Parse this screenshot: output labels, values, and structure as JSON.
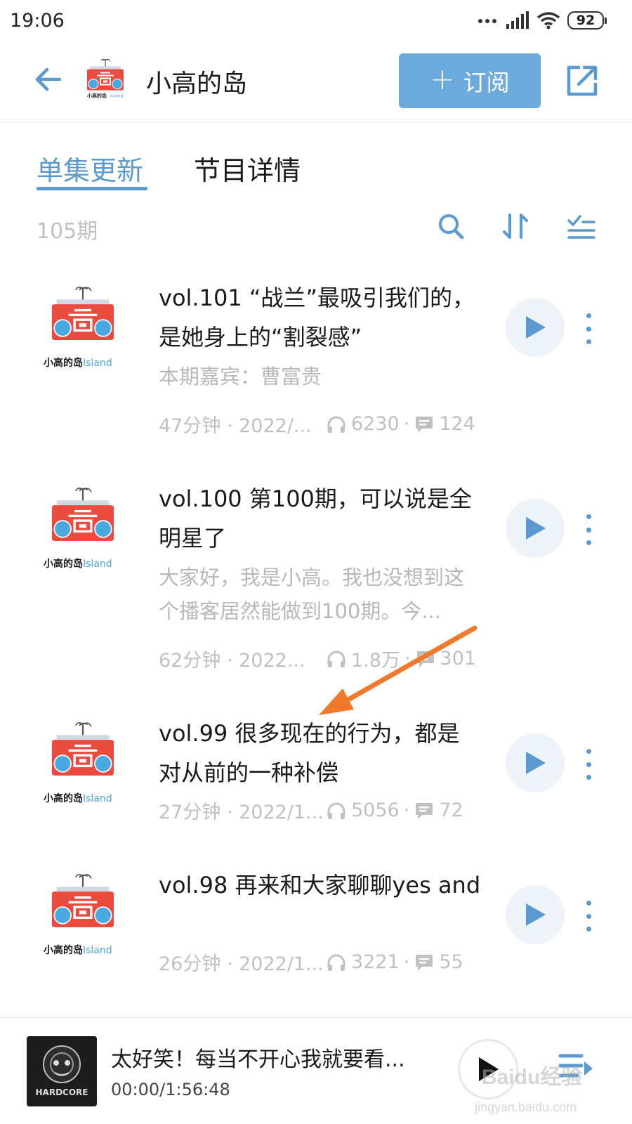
{
  "status_bar": {
    "time": "19:06",
    "battery": "92"
  },
  "header": {
    "title": "小高的岛",
    "subscribe_label": "订阅",
    "logo_caption": "小高的岛",
    "logo_caption_en": "Island"
  },
  "tabs": {
    "active": "单集更新",
    "inactive": "节目详情"
  },
  "toolbar": {
    "episode_count": "105期"
  },
  "episodes": [
    {
      "title": "vol.101 “战兰”最吸引我们的，是她身上的“割裂感”",
      "description": "本期嘉宾：曹富贵",
      "duration": "47分钟 · 2022/...",
      "plays": "6230",
      "comments": "124"
    },
    {
      "title": "vol.100 第100期，可以说是全明星了",
      "description": "大家好，我是小高。我也没想到这个播客居然能做到100期。今...",
      "duration": "62分钟 · 2022...",
      "plays": "1.8万",
      "comments": "301"
    },
    {
      "title": "vol.99 很多现在的行为，都是对从前的一种补偿",
      "description": "",
      "duration": "27分钟 · 2022/1...",
      "plays": "5056",
      "comments": "72"
    },
    {
      "title": "vol.98 再来和大家聊聊yes and",
      "description": "",
      "duration": "26分钟 · 2022/1...",
      "plays": "3221",
      "comments": "55"
    }
  ],
  "mini_player": {
    "title": "太好笑！每当不开心我就要看...",
    "time": "00:00/1:56:48",
    "cover_text": "HARDCORE"
  },
  "watermark": {
    "text": "Baidu经验",
    "sub": "jingyan.baidu.com"
  },
  "colors": {
    "accent": "#5a9ad0",
    "subscribe_bg": "#6ca9dc",
    "arrow": "#f07a2a",
    "cover_red": "#e94b3f",
    "cover_blue": "#4aa8e0"
  }
}
